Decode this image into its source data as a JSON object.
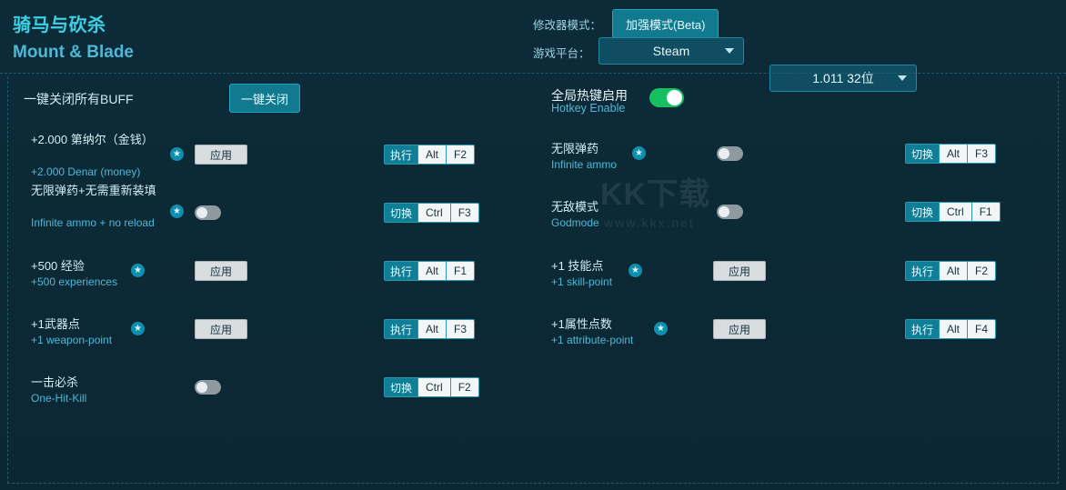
{
  "header": {
    "title_zh": "骑马与砍杀",
    "title_en": "Mount & Blade",
    "mode_label": "修改器模式：",
    "mode_button": "加强模式(Beta)",
    "platform_label": "游戏平台：",
    "platform_value": "Steam",
    "version_value": "1.011 32位"
  },
  "topbar": {
    "close_all_label": "一键关闭所有BUFF",
    "close_all_button": "一键关闭",
    "hotkey_zh": "全局热键启用",
    "hotkey_en": "Hotkey Enable",
    "hotkey_state": "on"
  },
  "watermark": {
    "main": "KK下载",
    "sub": "www.kkx.net"
  },
  "colors": {
    "accent": "#3fd0e6",
    "label_en": "#4fb8d6",
    "button": "#127a8e",
    "toggle_on": "#16c060",
    "toggle_off": "#8e9aa0",
    "hotkey_action": "#0f7f98",
    "background": "#0b2733"
  },
  "left_rows": [
    {
      "zh": "+2.000 第纳尔（金钱）",
      "en": "+2.000 Denar (money)",
      "star": "★",
      "control": "apply",
      "control_label": "应用",
      "hotkey": {
        "action": "执行",
        "mod": "Alt",
        "key": "F2"
      }
    },
    {
      "zh": "无限弹药+无需重新装填",
      "en": "Infinite ammo + no reload",
      "star": "★",
      "control": "toggle-off",
      "control_label": "",
      "hotkey": {
        "action": "切换",
        "mod": "Ctrl",
        "key": "F3"
      }
    },
    {
      "zh": "+500 经验",
      "en": "+500 experiences",
      "star": "★",
      "control": "apply",
      "control_label": "应用",
      "hotkey": {
        "action": "执行",
        "mod": "Alt",
        "key": "F1"
      }
    },
    {
      "zh": "+1武器点",
      "en": "+1 weapon-point",
      "star": "★",
      "control": "apply",
      "control_label": "应用",
      "hotkey": {
        "action": "执行",
        "mod": "Alt",
        "key": "F3"
      }
    },
    {
      "zh": "一击必杀",
      "en": "One-Hit-Kill",
      "star": "",
      "control": "toggle-off",
      "control_label": "",
      "hotkey": {
        "action": "切换",
        "mod": "Ctrl",
        "key": "F2"
      }
    }
  ],
  "right_rows": [
    {
      "zh": "无限弹药",
      "en": "Infinite ammo",
      "star": "★",
      "control": "toggle-off",
      "control_label": "",
      "hotkey": {
        "action": "切换",
        "mod": "Alt",
        "key": "F3"
      }
    },
    {
      "zh": "无敌模式",
      "en": "Godmode",
      "star": "",
      "control": "toggle-off",
      "control_label": "",
      "hotkey": {
        "action": "切换",
        "mod": "Ctrl",
        "key": "F1"
      }
    },
    {
      "zh": "+1 技能点",
      "en": "+1 skill-point",
      "star": "★",
      "control": "apply",
      "control_label": "应用",
      "hotkey": {
        "action": "执行",
        "mod": "Alt",
        "key": "F2"
      }
    },
    {
      "zh": "+1属性点数",
      "en": "+1 attribute-point",
      "star": "★",
      "control": "apply",
      "control_label": "应用",
      "hotkey": {
        "action": "执行",
        "mod": "Alt",
        "key": "F4"
      }
    }
  ]
}
